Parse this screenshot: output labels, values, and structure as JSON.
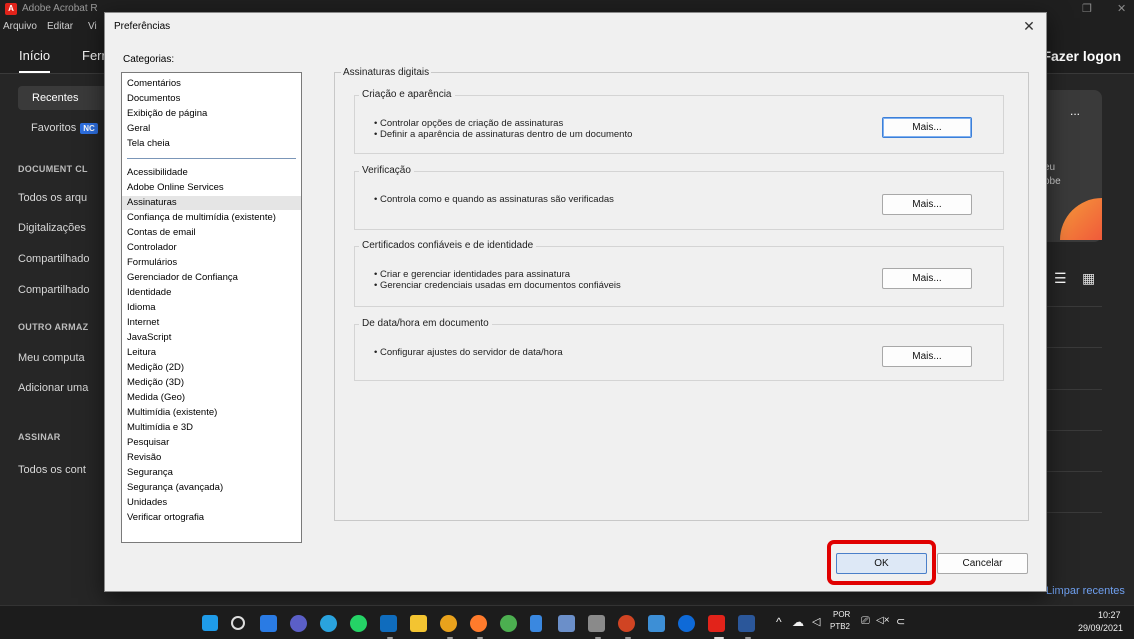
{
  "background_app": {
    "title": "Adobe Acrobat Re... DC (64-bit)",
    "title_visible": "Adobe Acrobat R",
    "menu": [
      "Arquivo",
      "Editar",
      "Vi"
    ],
    "tabs": [
      "Início",
      "Ferr"
    ],
    "login": "Fazer logon",
    "sidebar": {
      "recent": "Recentes",
      "favorites": "Favoritos",
      "favorites_badge": "NC",
      "section1": "DOCUMENT CL",
      "items1": [
        "Todos os arqu",
        "Digitalizações",
        "Compartilhado",
        "Compartilhado"
      ],
      "section2": "OUTRO ARMAZ",
      "items2": [
        "Meu computa",
        "Adicionar uma"
      ],
      "section3": "ASSINAR",
      "items3": [
        "Todos os cont"
      ]
    },
    "right": {
      "dots": "...",
      "text1": "eu",
      "text2": "obe",
      "clear_recent": "Limpar recentes"
    }
  },
  "dialog": {
    "title": "Preferências",
    "close": "✕",
    "categories_label": "Categorias:",
    "categories_top": [
      "Comentários",
      "Documentos",
      "Exibição de página",
      "Geral",
      "Tela cheia"
    ],
    "categories": [
      "Acessibilidade",
      "Adobe Online Services",
      "Assinaturas",
      "Confiança de multimídia (existente)",
      "Contas de email",
      "Controlador",
      "Formulários",
      "Gerenciador de Confiança",
      "Identidade",
      "Idioma",
      "Internet",
      "JavaScript",
      "Leitura",
      "Medição (2D)",
      "Medição (3D)",
      "Medida (Geo)",
      "Multimídia (existente)",
      "Multimídia e 3D",
      "Pesquisar",
      "Revisão",
      "Segurança",
      "Segurança (avançada)",
      "Unidades",
      "Verificar ortografia"
    ],
    "selected_category": "Assinaturas",
    "panel_title": "Assinaturas digitais",
    "groups": [
      {
        "title": "Criação e aparência",
        "bullets": [
          "• Controlar opções de criação de assinaturas",
          "• Definir a aparência de assinaturas dentro de um documento"
        ],
        "button": "Mais..."
      },
      {
        "title": "Verificação",
        "bullets": [
          "• Controla como e quando as assinaturas são verificadas"
        ],
        "button": "Mais..."
      },
      {
        "title": "Certificados confiáveis e de identidade",
        "bullets": [
          "• Criar e gerenciar identidades para assinatura",
          "• Gerenciar credenciais usadas em documentos confiáveis"
        ],
        "button": "Mais..."
      },
      {
        "title": "De data/hora em documento",
        "bullets": [
          "• Configurar ajustes do servidor de data/hora"
        ],
        "button": "Mais..."
      }
    ],
    "ok": "OK",
    "cancel": "Cancelar"
  },
  "taskbar": {
    "icons": [
      "windows-start-icon",
      "search-icon",
      "task-view-icon",
      "chat-icon",
      "telegram-icon",
      "whatsapp-icon",
      "outlook-icon",
      "file-explorer-icon",
      "app-6-icon",
      "firefox-icon",
      "chrome-icon",
      "notepad-icon",
      "app-13-icon",
      "app-14-icon",
      "powerpoint-icon",
      "app-16-icon",
      "teamviewer-icon",
      "acrobat-icon",
      "word-icon"
    ],
    "language_line1": "POR",
    "language_line2": "PTB2",
    "time": "10:27",
    "date": "29/09/2021",
    "tray_glyphs": {
      "chevron": "^",
      "cloud": "☁",
      "location": "◁",
      "display": "⎚",
      "volume": "◁×",
      "battery": "⊂"
    }
  }
}
